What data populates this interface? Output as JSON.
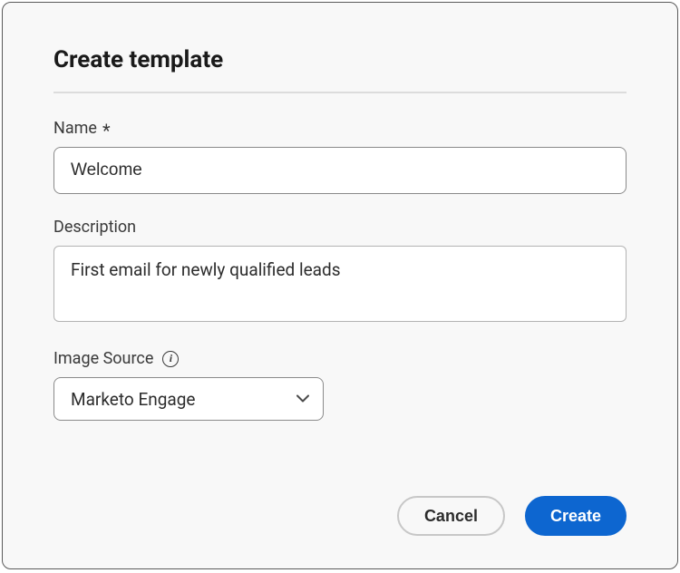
{
  "dialog": {
    "title": "Create template"
  },
  "fields": {
    "name": {
      "label": "Name",
      "required_marker": "*",
      "value": "Welcome"
    },
    "description": {
      "label": "Description",
      "value": "First email for newly qualified leads"
    },
    "image_source": {
      "label": "Image Source",
      "selected": "Marketo Engage"
    }
  },
  "buttons": {
    "cancel": "Cancel",
    "create": "Create"
  }
}
